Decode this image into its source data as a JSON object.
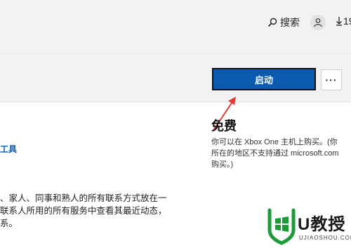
{
  "header": {
    "search_label": "搜索",
    "download_count": "19"
  },
  "actions": {
    "launch_label": "启动",
    "more_label": "···"
  },
  "left": {
    "link_text": "工具",
    "description_lines": [
      "、家人、同事和熟人的所有联系方式放在一",
      "联系人所用的所有服务中查看其最近动态，",
      "系。"
    ]
  },
  "price": {
    "title": "免费",
    "note": "你可以在 Xbox One 主机上购买。(你所在的地区不支持通过 microsoft.com 购买。)"
  },
  "watermark": {
    "brand": "U教授",
    "site": "UJIAOSHOU.COM"
  },
  "colors": {
    "accent": "#0a5bb0",
    "arrow": "#e53935",
    "watermark_green": "#1e9a3a"
  }
}
